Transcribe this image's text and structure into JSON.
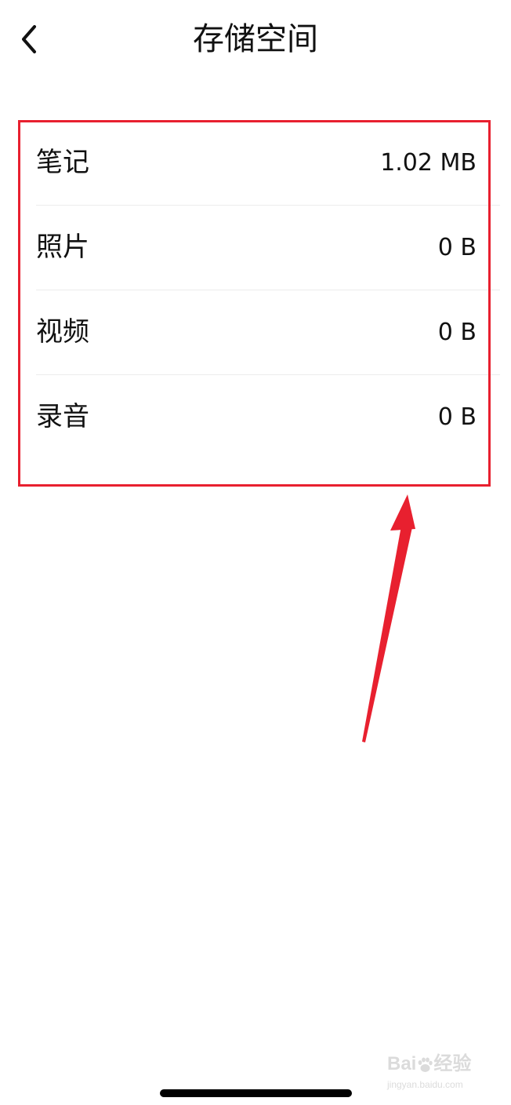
{
  "header": {
    "title": "存储空间",
    "back_icon": "chevron-left-icon"
  },
  "storage": {
    "items": [
      {
        "label": "笔记",
        "value": "1.02 MB"
      },
      {
        "label": "照片",
        "value": "0 B"
      },
      {
        "label": "视频",
        "value": "0 B"
      },
      {
        "label": "录音",
        "value": "0 B"
      }
    ]
  },
  "annotation": {
    "color": "#e8202f",
    "shapes": [
      "highlight-rectangle",
      "pointer-arrow"
    ]
  },
  "watermark": {
    "brand_left": "Bai",
    "brand_right": "经验",
    "url": "jingyan.baidu.com",
    "icon": "paw-icon"
  }
}
